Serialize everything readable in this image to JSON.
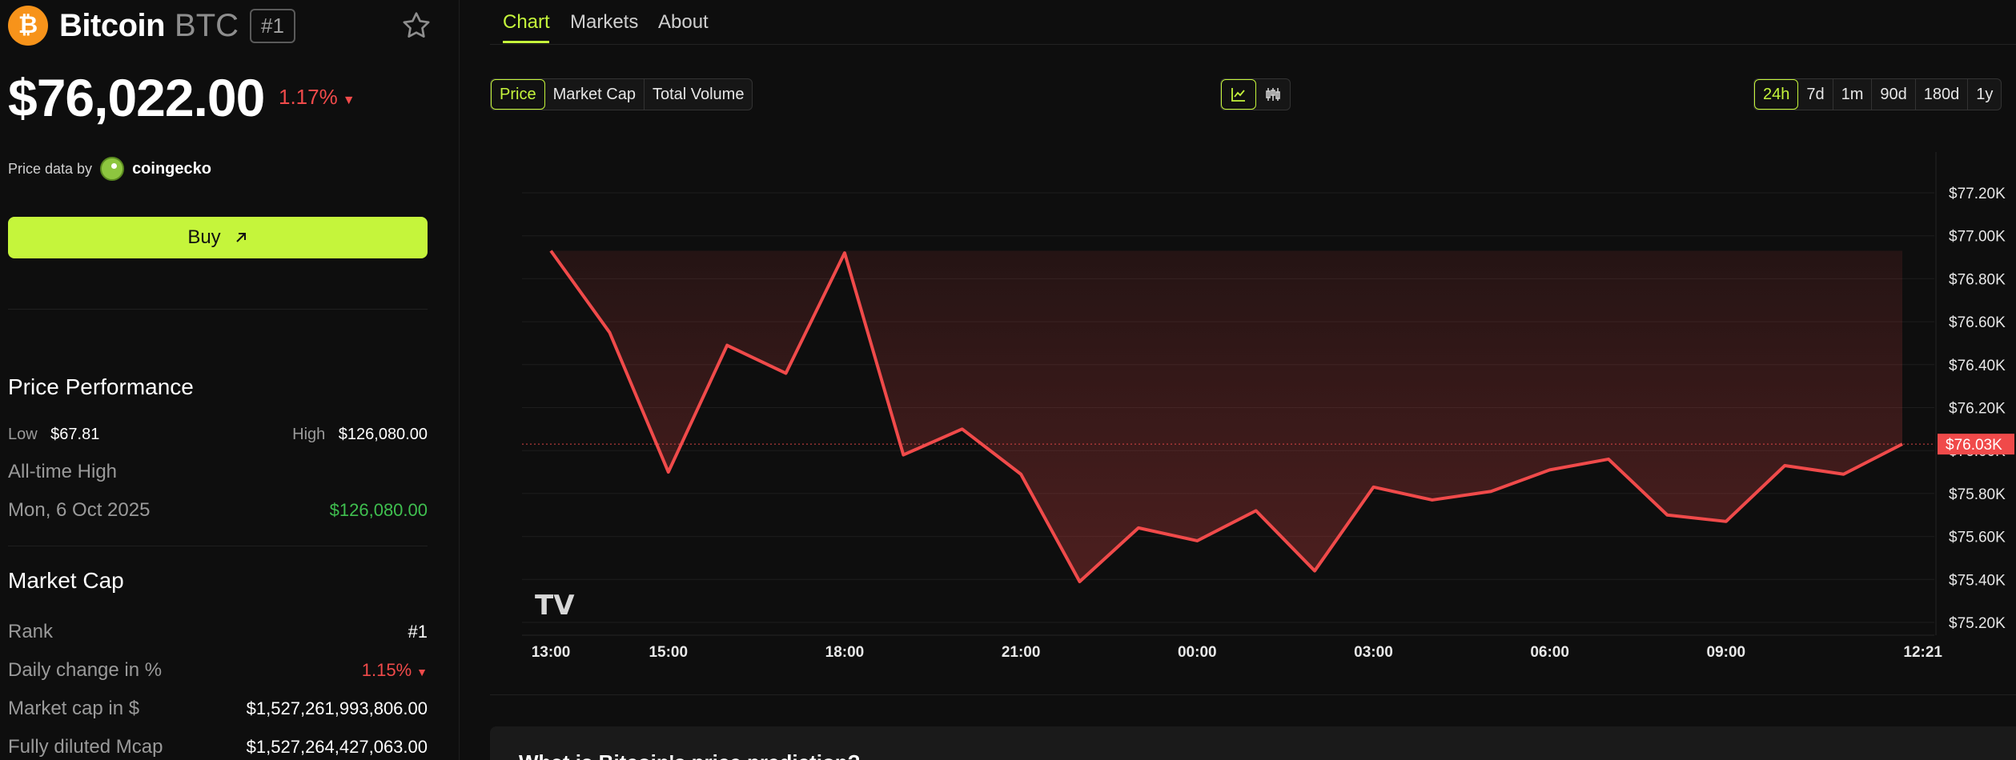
{
  "coin": {
    "logo_glyph": "₿",
    "name": "Bitcoin",
    "symbol": "BTC",
    "rank": "#1",
    "price": "$76,022.00",
    "change": "1.17%",
    "change_color": "#f04a4a",
    "star_icon": "star-outline-icon"
  },
  "price_data": {
    "label": "Price data by",
    "provider": "coingecko"
  },
  "buy": {
    "label": "Buy",
    "icon": "arrow-up-right-icon",
    "color": "#c5f53b"
  },
  "performance": {
    "title": "Price Performance",
    "low_label": "Low",
    "low_value": "$67.81",
    "high_label": "High",
    "high_value": "$126,080.00",
    "ath_label": "All-time High",
    "ath_date": "Mon, 6 Oct 2025",
    "ath_value": "$126,080.00"
  },
  "market_cap": {
    "title": "Market Cap",
    "rows": [
      {
        "label": "Rank",
        "value": "#1"
      },
      {
        "label": "Daily change in %",
        "value": "1.15%"
      },
      {
        "label": "Market cap in $",
        "value": "$1,527,261,993,806.00"
      },
      {
        "label": "Fully diluted Mcap",
        "value": "$1,527,264,427,063.00"
      }
    ]
  },
  "tabs": [
    "Chart",
    "Markets",
    "About"
  ],
  "metric_options": [
    "Price",
    "Market Cap",
    "Total Volume"
  ],
  "chart_type_icons": [
    "line-chart-icon",
    "candlestick-icon"
  ],
  "range_options": [
    "24h",
    "7d",
    "1m",
    "90d",
    "180d",
    "1y"
  ],
  "watermark": "TV",
  "next_section_title": "What is Bitcoin's price prediction?",
  "chart_data": {
    "type": "area",
    "series_color": "#f04a4a",
    "current_label": "$76.03K",
    "x_ticks": [
      "13:00",
      "15:00",
      "18:00",
      "21:00",
      "00:00",
      "03:00",
      "06:00",
      "09:00",
      "12:21"
    ],
    "y_ticks": [
      "$77.20K",
      "$77.00K",
      "$76.80K",
      "$76.60K",
      "$76.40K",
      "$76.20K",
      "$76.00K",
      "$75.80K",
      "$75.60K",
      "$75.40K",
      "$75.20K"
    ],
    "ylim": [
      75.2,
      77.2
    ],
    "x_unit": "hours since 12:30",
    "points": [
      [
        0.5,
        76.93
      ],
      [
        1.5,
        76.55
      ],
      [
        2.5,
        75.9
      ],
      [
        3.5,
        76.49
      ],
      [
        4.5,
        76.36
      ],
      [
        5.5,
        76.92
      ],
      [
        6.5,
        75.98
      ],
      [
        7.5,
        76.1
      ],
      [
        8.5,
        75.89
      ],
      [
        9.5,
        75.39
      ],
      [
        10.5,
        75.64
      ],
      [
        11.5,
        75.58
      ],
      [
        12.5,
        75.72
      ],
      [
        13.5,
        75.44
      ],
      [
        14.5,
        75.83
      ],
      [
        15.5,
        75.77
      ],
      [
        16.5,
        75.81
      ],
      [
        17.5,
        75.91
      ],
      [
        18.5,
        75.96
      ],
      [
        19.5,
        75.7
      ],
      [
        20.5,
        75.67
      ],
      [
        21.5,
        75.93
      ],
      [
        22.5,
        75.89
      ],
      [
        23.5,
        76.03
      ]
    ],
    "x_tick_positions": [
      0.5,
      2.5,
      5.5,
      8.5,
      11.5,
      14.5,
      17.5,
      20.5,
      23.85
    ]
  }
}
